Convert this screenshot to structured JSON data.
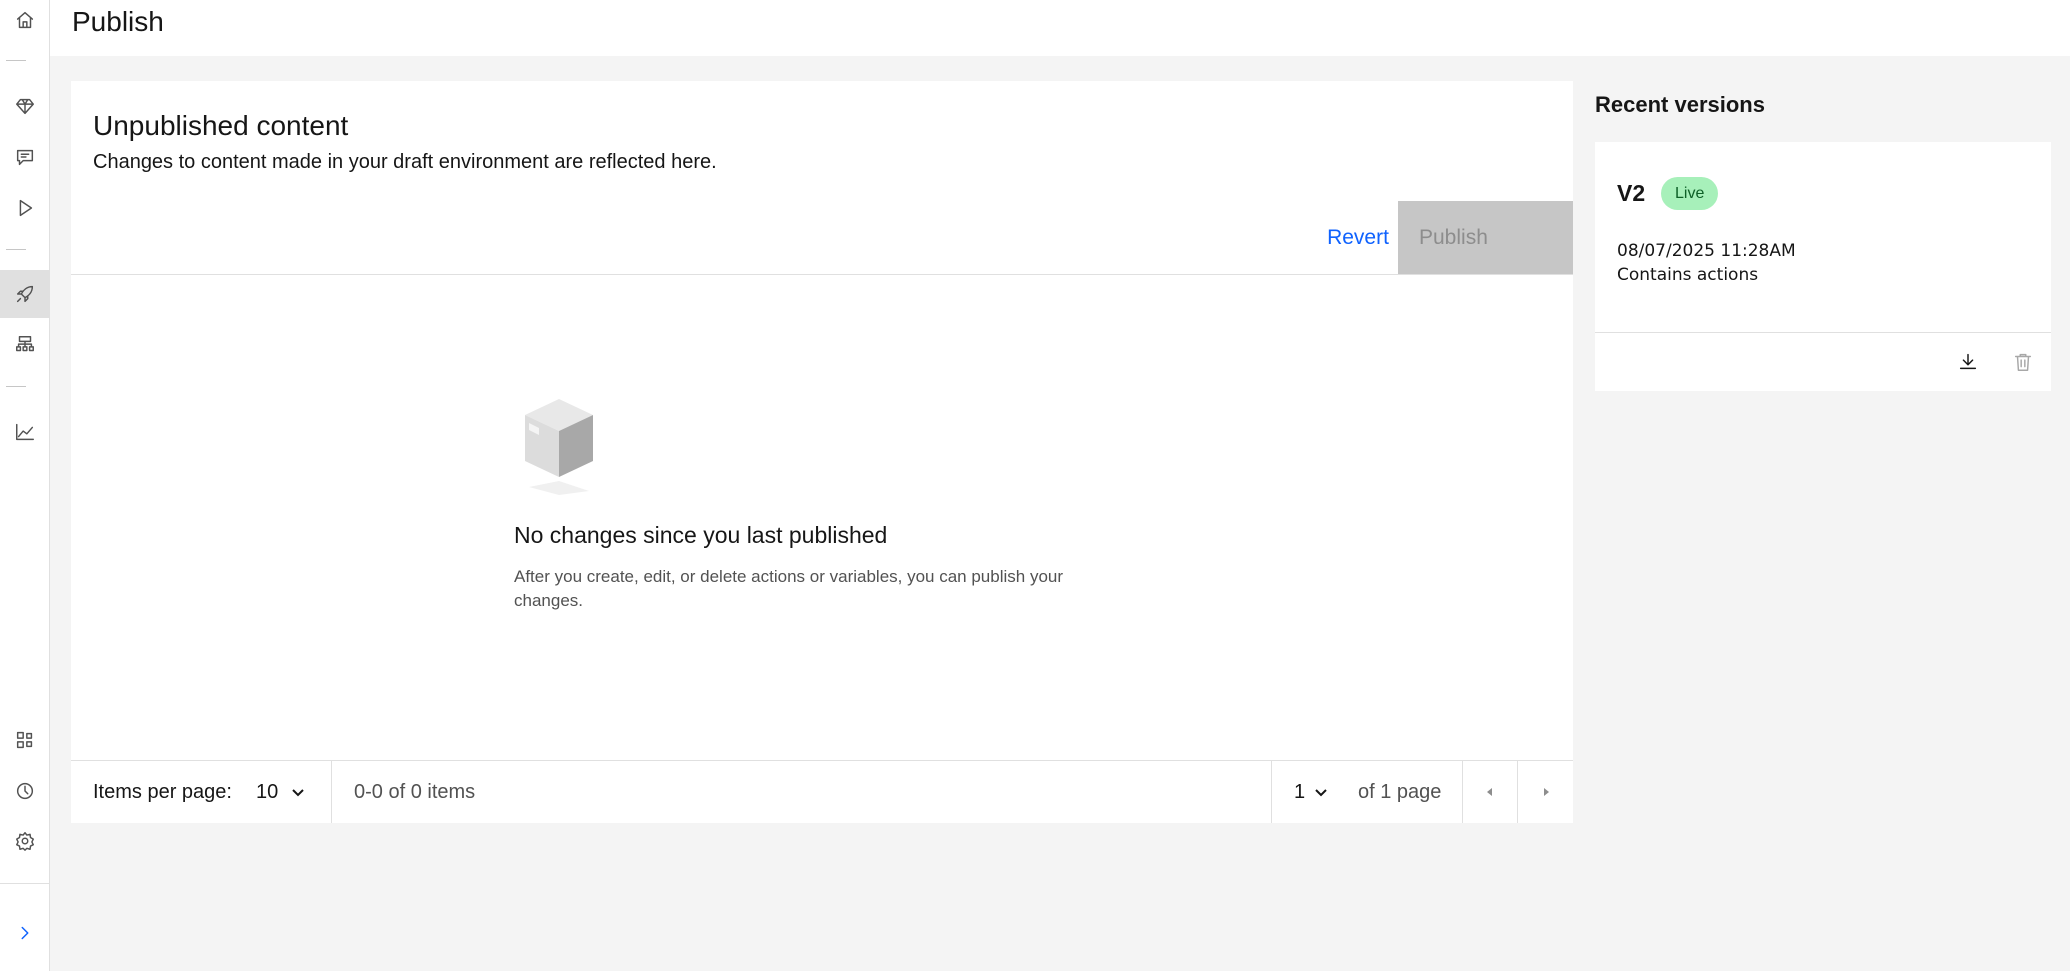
{
  "header": {
    "title": "Publish"
  },
  "sidebar": {
    "items": [
      {
        "name": "home-icon",
        "active": false
      },
      {
        "name": "diamond-icon",
        "active": false
      },
      {
        "name": "chat-icon",
        "active": false
      },
      {
        "name": "play-icon",
        "active": false
      },
      {
        "name": "rocket-icon",
        "active": true
      },
      {
        "name": "flow-icon",
        "active": false
      },
      {
        "name": "analytics-icon",
        "active": false
      },
      {
        "name": "integrations-icon",
        "active": false
      },
      {
        "name": "history-icon",
        "active": false
      },
      {
        "name": "settings-icon",
        "active": false
      },
      {
        "name": "expand-chevron-icon",
        "active": false
      }
    ]
  },
  "unpublished": {
    "title": "Unpublished content",
    "description": "Changes to content made in your draft environment are reflected here.",
    "revert_label": "Revert",
    "publish_label": "Publish",
    "empty_title": "No changes since you last published",
    "empty_description": "After you create, edit, or delete actions or variables, you can publish your changes."
  },
  "pagination": {
    "items_per_page_label": "Items per page:",
    "items_per_page_value": "10",
    "range_text": "0-0 of 0 items",
    "current_page": "1",
    "page_total_text": "of 1 page"
  },
  "recent_versions": {
    "title": "Recent versions",
    "versions": [
      {
        "name": "V2",
        "badge": "Live",
        "timestamp": "08/07/2025 11:28AM",
        "note": "Contains actions"
      }
    ]
  },
  "colors": {
    "link": "#0f62fe",
    "live_badge_bg": "#a7f0ba",
    "live_badge_text": "#0e6027",
    "disabled_button": "#c6c6c6"
  }
}
